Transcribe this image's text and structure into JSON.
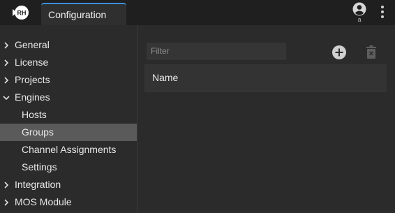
{
  "header": {
    "logo_text": "RH",
    "tab_label": "Configuration",
    "user_initial": "a"
  },
  "sidebar": {
    "items": [
      {
        "label": "General",
        "level": 0,
        "expanded": false,
        "selected": false
      },
      {
        "label": "License",
        "level": 0,
        "expanded": false,
        "selected": false
      },
      {
        "label": "Projects",
        "level": 0,
        "expanded": false,
        "selected": false
      },
      {
        "label": "Engines",
        "level": 0,
        "expanded": true,
        "selected": false
      },
      {
        "label": "Hosts",
        "level": 1,
        "selected": false
      },
      {
        "label": "Groups",
        "level": 1,
        "selected": true
      },
      {
        "label": "Channel Assignments",
        "level": 1,
        "selected": false
      },
      {
        "label": "Settings",
        "level": 1,
        "selected": false
      },
      {
        "label": "Integration",
        "level": 0,
        "expanded": false,
        "selected": false
      },
      {
        "label": "MOS Module",
        "level": 0,
        "expanded": false,
        "selected": false
      }
    ]
  },
  "main": {
    "filter_placeholder": "Filter",
    "filter_value": "",
    "table": {
      "columns": [
        "Name"
      ],
      "rows": []
    }
  },
  "icons": {
    "add": "plus-circle-icon",
    "delete": "trash-icon",
    "user": "account-circle-icon",
    "menu": "kebab-menu-icon"
  },
  "colors": {
    "accent": "#3d8fd9",
    "selected_bg": "#5a5a5a",
    "topbar_bg": "#1f1f1f",
    "panel_bg": "#2b2b2b"
  }
}
